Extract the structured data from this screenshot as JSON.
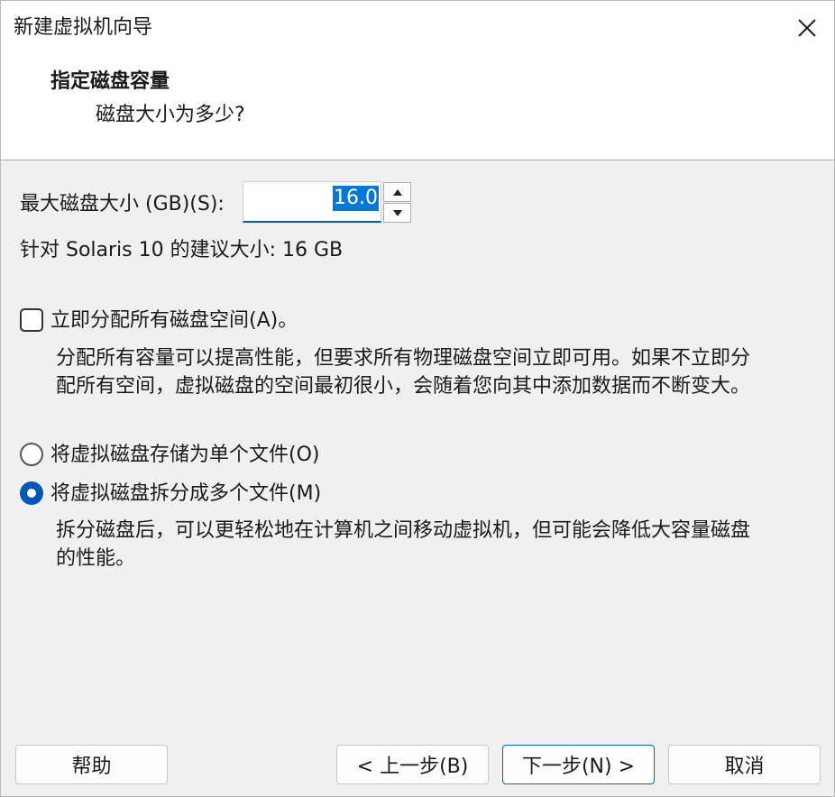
{
  "window": {
    "title": "新建虚拟机向导",
    "close_icon": "close-icon"
  },
  "header": {
    "title": "指定磁盘容量",
    "subtitle": "磁盘大小为多少?"
  },
  "disk_size": {
    "label": "最大磁盘大小 (GB)(S):",
    "value": "16.0"
  },
  "recommended": {
    "text": "针对 Solaris 10 的建议大小: 16 GB"
  },
  "allocate": {
    "label": "立即分配所有磁盘空间(A)。",
    "checked": false,
    "description_line1": "分配所有容量可以提高性能，但要求所有物理磁盘空间立即可用。如果不立即分",
    "description_line2": "配所有空间，虚拟磁盘的空间最初很小，会随着您向其中添加数据而不断变大。"
  },
  "storage": {
    "single_label": "将虚拟磁盘存储为单个文件(O)",
    "multi_label": "将虚拟磁盘拆分成多个文件(M)",
    "selected": "multi",
    "multi_description_line1": "拆分磁盘后，可以更轻松地在计算机之间移动虚拟机，但可能会降低大容量磁盘",
    "multi_description_line2": "的性能。"
  },
  "buttons": {
    "help": "帮助",
    "back": "< 上一步(B)",
    "next": "下一步(N) >",
    "cancel": "取消"
  },
  "colors": {
    "accent": "#0057b7",
    "selection": "#0078d7",
    "background": "#f0f0f0"
  }
}
